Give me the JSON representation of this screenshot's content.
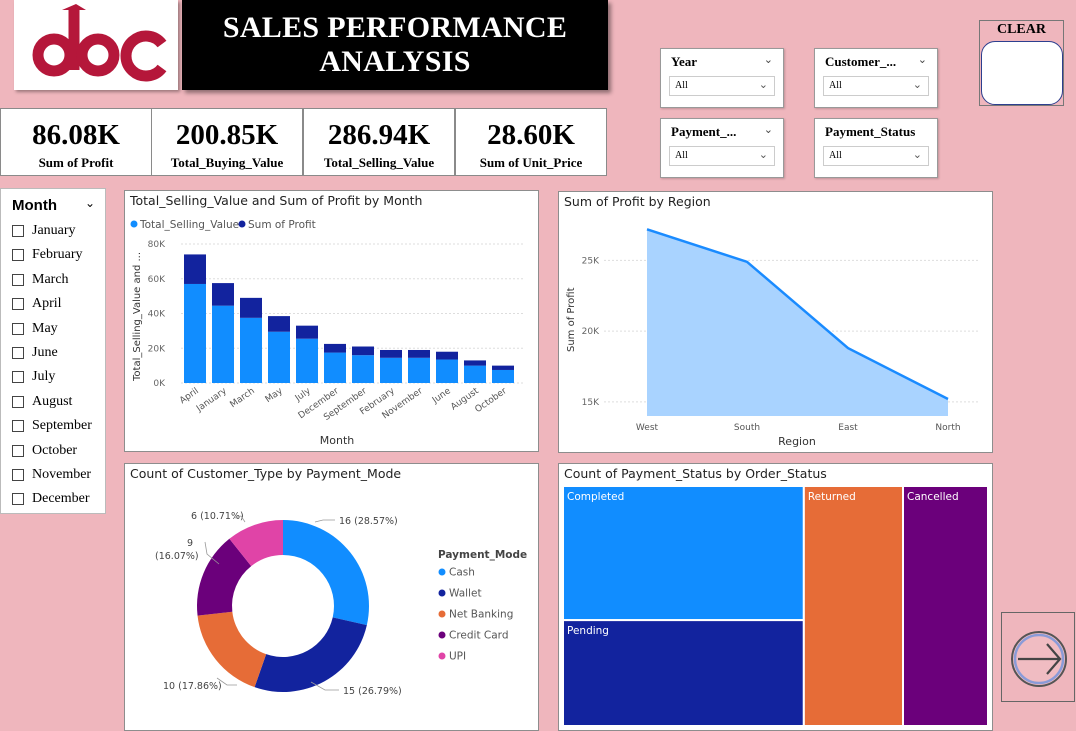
{
  "header": {
    "logo_text": "abc",
    "title_line1": "SALES PERFORMANCE",
    "title_line2": "ANALYSIS"
  },
  "kpis": [
    {
      "value": "86.08K",
      "label": "Sum of Profit"
    },
    {
      "value": "200.85K",
      "label": "Total_Buying_Value"
    },
    {
      "value": "286.94K",
      "label": "Total_Selling_Value"
    },
    {
      "value": "28.60K",
      "label": "Sum of Unit_Price"
    }
  ],
  "slicers": {
    "year": {
      "label": "Year",
      "value": "All"
    },
    "customer": {
      "label": "Customer_...",
      "value": "All"
    },
    "payment_mode": {
      "label": "Payment_...",
      "value": "All"
    },
    "payment_status": {
      "label": "Payment_Status",
      "value": "All"
    }
  },
  "clear_button": {
    "label": "CLEAR"
  },
  "month_slicer": {
    "title": "Month",
    "items": [
      "January",
      "February",
      "March",
      "April",
      "May",
      "June",
      "July",
      "August",
      "September",
      "October",
      "November",
      "December"
    ]
  },
  "colors": {
    "background": "#efb6bd",
    "light_blue": "#118DFF",
    "dark_blue": "#12239E",
    "orange": "#E66C37",
    "purple": "#6B007B",
    "pink": "#E044A7",
    "area_fill": "#A9D3FF",
    "area_line": "#1A8BFF"
  },
  "charts": {
    "bar": {
      "title": "Total_Selling_Value and Sum of Profit by Month",
      "legend": [
        "Total_Selling_Value",
        "Sum of Profit"
      ],
      "ylabel": "Total_Selling_Value and ...",
      "xlabel": "Month",
      "yticks": [
        "0K",
        "20K",
        "40K",
        "60K",
        "80K"
      ]
    },
    "area": {
      "title": "Sum of Profit by Region",
      "ylabel": "Sum of Profit",
      "xlabel": "Region",
      "yticks": [
        "15K",
        "20K",
        "25K"
      ]
    },
    "donut": {
      "title": "Count of Customer_Type by Payment_Mode",
      "legend_title": "Payment_Mode",
      "labels": [
        "16 (28.57%)",
        "15 (26.79%)",
        "10 (17.86%)",
        "9",
        "(16.07%)",
        "6 (10.71%)"
      ]
    },
    "treemap": {
      "title": "Count of Payment_Status by Order_Status"
    }
  },
  "chart_data": [
    {
      "type": "bar",
      "stacked": true,
      "title": "Total_Selling_Value and Sum of Profit by Month",
      "categories": [
        "April",
        "January",
        "March",
        "May",
        "July",
        "December",
        "September",
        "February",
        "November",
        "June",
        "August",
        "October"
      ],
      "series": [
        {
          "name": "Total_Selling_Value",
          "values": [
            57000,
            44500,
            37500,
            29500,
            25500,
            17500,
            16000,
            14500,
            14500,
            13500,
            10000,
            7500
          ]
        },
        {
          "name": "Sum of Profit",
          "values": [
            17000,
            13000,
            11500,
            9000,
            7500,
            5000,
            5000,
            4500,
            4500,
            4500,
            3000,
            2500
          ]
        }
      ],
      "xlabel": "Month",
      "ylabel": "Total_Selling_Value and ...",
      "ylim": [
        0,
        80000
      ],
      "grid": true,
      "legend": "top-left"
    },
    {
      "type": "area",
      "title": "Sum of Profit by Region",
      "categories": [
        "West",
        "South",
        "East",
        "North"
      ],
      "values": [
        27200,
        24900,
        18800,
        15200
      ],
      "xlabel": "Region",
      "ylabel": "Sum of Profit",
      "ylim": [
        14000,
        28000
      ],
      "grid": true
    },
    {
      "type": "pie",
      "donut": true,
      "title": "Count of Customer_Type by Payment_Mode",
      "categories": [
        "Cash",
        "Wallet",
        "Net Banking",
        "Credit Card",
        "UPI"
      ],
      "values": [
        16,
        15,
        10,
        9,
        6
      ],
      "legend": "right"
    },
    {
      "type": "table",
      "subtype": "treemap",
      "title": "Count of Payment_Status by Order_Status",
      "nodes": [
        {
          "name": "Completed",
          "children": [
            {
              "name": "Completed",
              "value": 19
            },
            {
              "name": "Pending",
              "value": 15
            }
          ]
        },
        {
          "name": "Returned",
          "value": 14
        },
        {
          "name": "Cancelled",
          "value": 12
        }
      ]
    }
  ]
}
